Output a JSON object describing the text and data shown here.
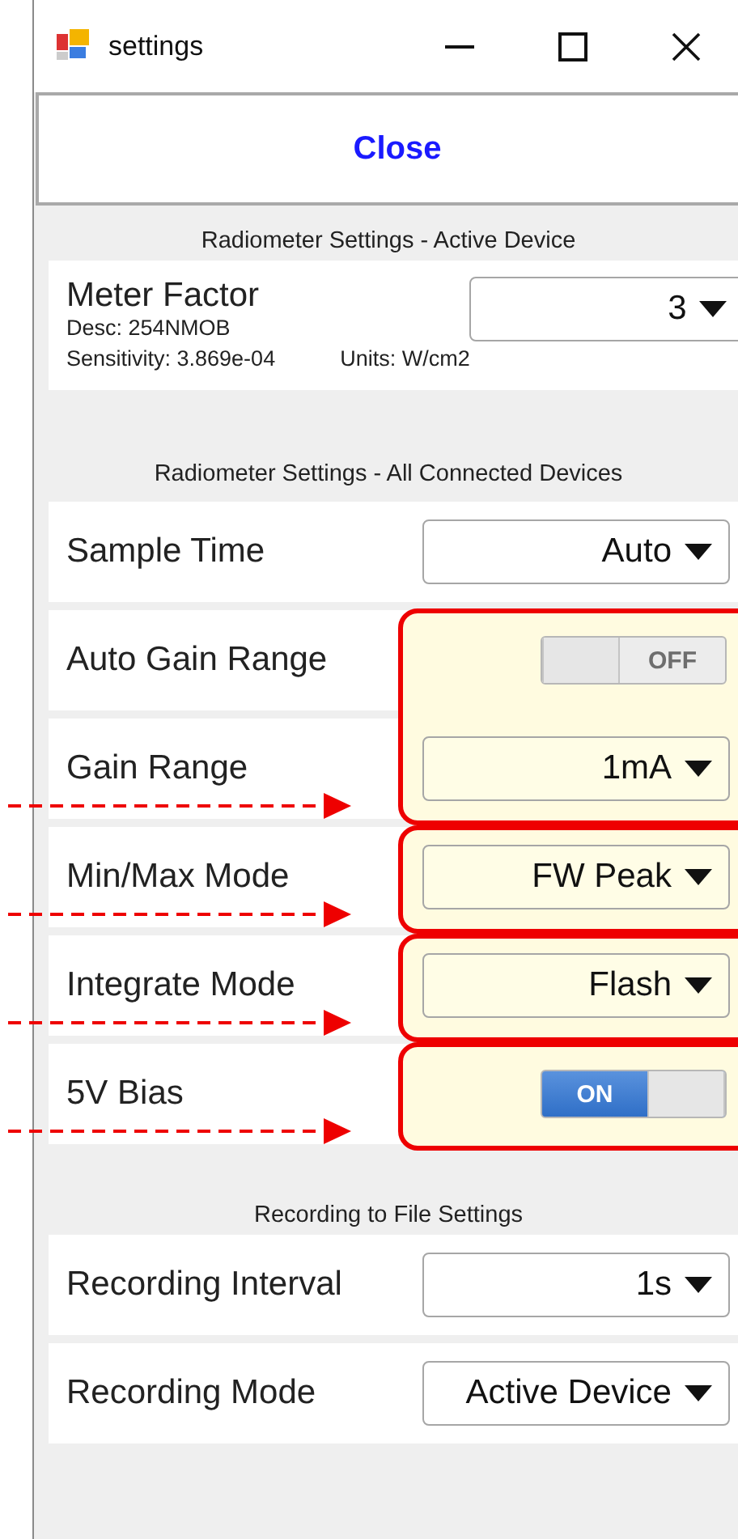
{
  "window": {
    "title": "settings"
  },
  "close_button": "Close",
  "active_device": {
    "heading": "Radiometer Settings - Active Device",
    "label": "Meter Factor",
    "desc": "Desc:  254NMOB",
    "sensitivity": "Sensitivity:  3.869e-04",
    "units": "Units:  W/cm2",
    "value": "3"
  },
  "all_devices": {
    "heading": "Radiometer Settings - All Connected Devices",
    "groups": [
      {
        "highlighted": false,
        "rows": [
          {
            "label": "Sample Time",
            "kind": "dropdown",
            "value": "Auto",
            "arrow": false
          }
        ]
      },
      {
        "highlighted": true,
        "rows": [
          {
            "label": "Auto Gain Range",
            "kind": "toggle",
            "on": false,
            "value": "OFF",
            "arrow": false
          },
          {
            "label": "Gain Range",
            "kind": "dropdown",
            "value": "1mA",
            "arrow": true
          }
        ]
      },
      {
        "highlighted": true,
        "rows": [
          {
            "label": "Min/Max Mode",
            "kind": "dropdown",
            "value": "FW Peak",
            "arrow": true
          }
        ]
      },
      {
        "highlighted": true,
        "rows": [
          {
            "label": "Integrate Mode",
            "kind": "dropdown",
            "value": "Flash",
            "arrow": true
          }
        ]
      },
      {
        "highlighted": true,
        "rows": [
          {
            "label": "5V Bias",
            "kind": "toggle",
            "on": true,
            "value": "ON",
            "arrow": true
          }
        ]
      }
    ]
  },
  "recording": {
    "heading": "Recording to File Settings",
    "rows": [
      {
        "label": "Recording Interval",
        "kind": "dropdown",
        "value": "1s"
      },
      {
        "label": "Recording Mode",
        "kind": "dropdown",
        "value": "Active Device"
      }
    ]
  }
}
